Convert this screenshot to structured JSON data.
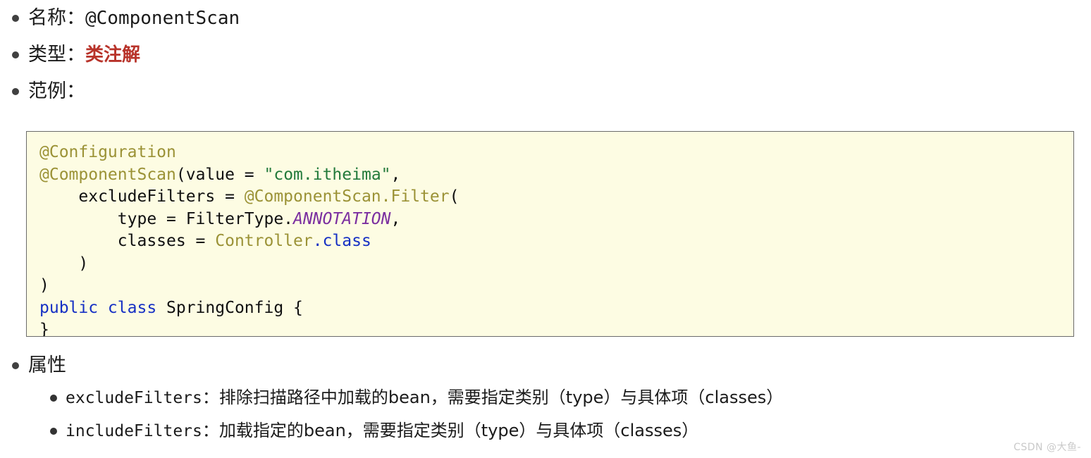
{
  "document": {
    "bullets": [
      {
        "label": "名称：",
        "value": "@ComponentScan",
        "value_style": "mono"
      },
      {
        "label": "类型：",
        "value": "类注解",
        "value_style": "highlight"
      },
      {
        "label": "范例：",
        "value": "",
        "value_style": "none"
      }
    ]
  },
  "code_block": {
    "language": "java",
    "background": "#fdfce3",
    "border_color": "#6b6b6b",
    "lines": [
      [
        {
          "t": "@Configuration",
          "c": "annotation"
        }
      ],
      [
        {
          "t": "@ComponentScan",
          "c": "annotation"
        },
        {
          "t": "(value = ",
          "c": "plain"
        },
        {
          "t": "\"com.itheima\"",
          "c": "string"
        },
        {
          "t": ",",
          "c": "plain"
        }
      ],
      [
        {
          "t": "    excludeFilters = ",
          "c": "plain"
        },
        {
          "t": "@ComponentScan.Filter",
          "c": "annotation"
        },
        {
          "t": "(",
          "c": "plain"
        }
      ],
      [
        {
          "t": "        type = FilterType.",
          "c": "plain"
        },
        {
          "t": "ANNOTATION",
          "c": "field"
        },
        {
          "t": ",",
          "c": "plain"
        }
      ],
      [
        {
          "t": "        classes = ",
          "c": "plain"
        },
        {
          "t": "Controller",
          "c": "class"
        },
        {
          "t": ".class",
          "c": "blue"
        }
      ],
      [
        {
          "t": "    )",
          "c": "plain"
        }
      ],
      [
        {
          "t": ")",
          "c": "plain"
        }
      ],
      [
        {
          "t": "public class",
          "c": "keyword"
        },
        {
          "t": " SpringConfig {",
          "c": "plain"
        }
      ],
      [
        {
          "t": "}",
          "c": "plain"
        }
      ]
    ]
  },
  "attributes": {
    "heading": "属性",
    "items": [
      {
        "name": "excludeFilters",
        "separator": "：",
        "description": "排除扫描路径中加载的bean，需要指定类别（type）与具体项（classes）"
      },
      {
        "name": "includeFilters",
        "separator": "：",
        "description": "加载指定的bean，需要指定类别（type）与具体项（classes）"
      }
    ]
  },
  "watermark": {
    "text": "CSDN @大鱼-"
  },
  "colors": {
    "accent_red": "#b8332a",
    "annotation": "#9b9236",
    "string": "#237a3b",
    "keyword": "#1630c4",
    "field": "#7b2fa0",
    "code_bg": "#fdfce3"
  }
}
